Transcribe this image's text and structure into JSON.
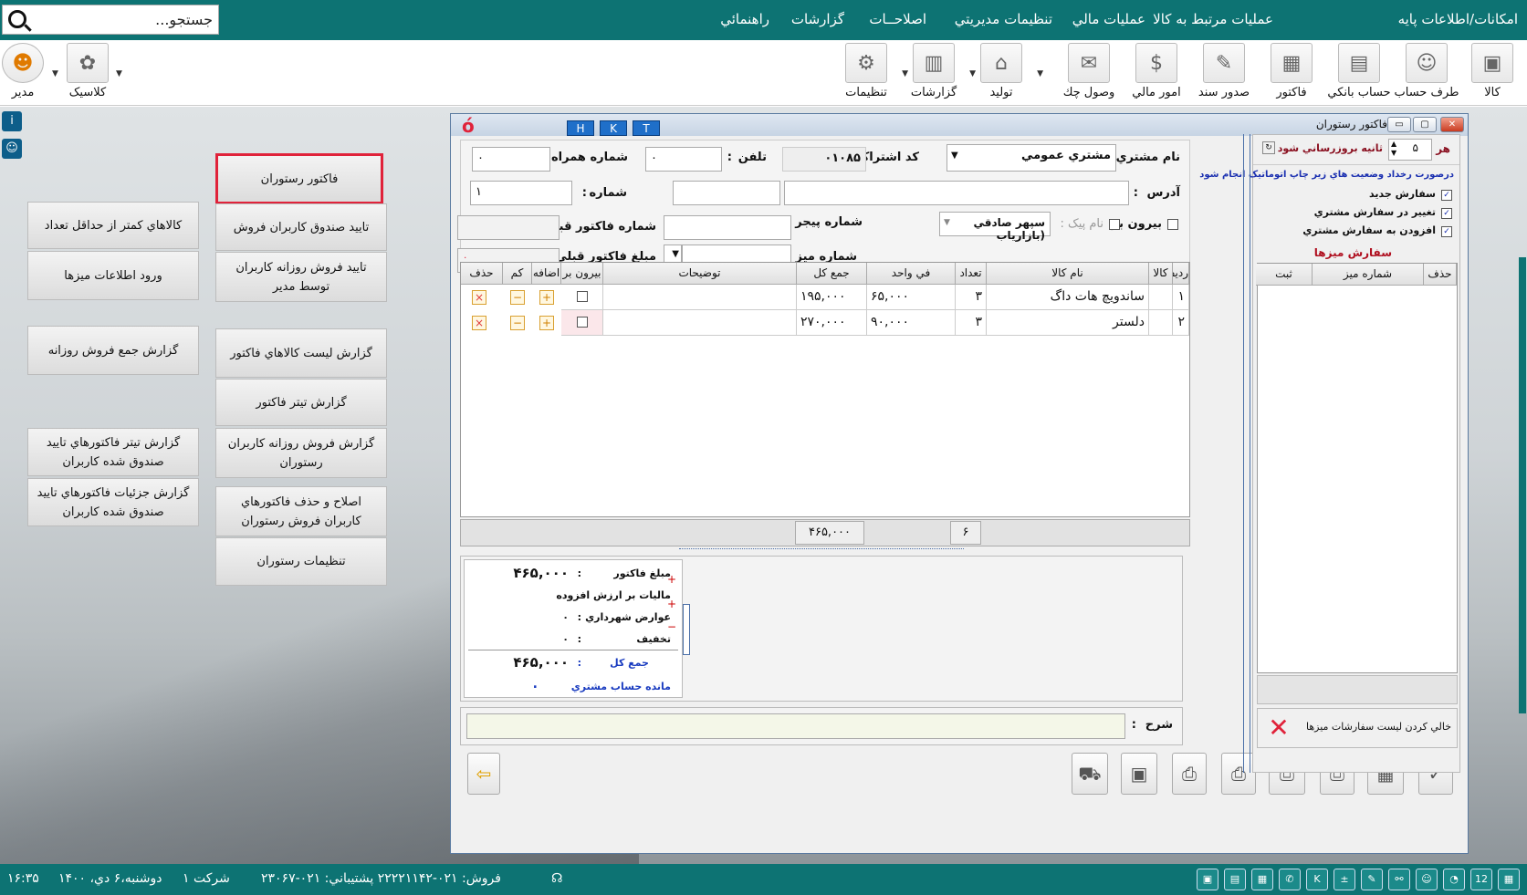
{
  "search": {
    "placeholder": "جستجو..."
  },
  "menu": [
    "امکانات/اطلاعات پايه",
    "عمليات مرتبط به کالا",
    "عمليات مالي",
    "تنظيمات مديريتي",
    "اصلاحــات",
    "گزارشات",
    "راهنمائي"
  ],
  "toolbar": {
    "right": [
      {
        "label": "کالا",
        "icon": "box-icon"
      },
      {
        "label": "طرف حساب",
        "icon": "person-icon"
      },
      {
        "label": "حساب بانکي",
        "icon": "bank-card-icon"
      },
      {
        "label": "فاکتور",
        "icon": "invoice-icon"
      },
      {
        "label": "صدور سند",
        "icon": "document-icon"
      },
      {
        "label": "امور مالي",
        "icon": "finance-icon"
      },
      {
        "label": "وصول چك",
        "icon": "cheque-icon"
      },
      {
        "label": "توليد",
        "icon": "production-icon"
      },
      {
        "label": "گزارشات",
        "icon": "report-icon"
      },
      {
        "label": "تنظيمات",
        "icon": "gear-icon"
      }
    ],
    "left": [
      {
        "label": "کلاسيک",
        "icon": "palette-icon"
      },
      {
        "label": "مدير",
        "icon": "user-icon"
      }
    ]
  },
  "left_buttons": [
    {
      "label": "فاكتور رستوران",
      "selected": true
    },
    {
      "label": "تاييد صندوق كاربران فروش"
    },
    {
      "label": "تاييد فروش روزانه کاربران توسط مدير"
    },
    {
      "label": "گزارش ليست كالاهاي فاكتور"
    },
    {
      "label": "گزارش تيتر فاكتور"
    },
    {
      "label": "گزارش فروش روزانه کاربران رستوران"
    },
    {
      "label": "اصلاح و حذف فاكتورهاي كاربران فروش رستوران"
    },
    {
      "label": "تنظيمات رستوران"
    },
    {
      "label": "كالاهاي كمتر از حداقل تعداد"
    },
    {
      "label": "ورود اطلاعات ميزها"
    },
    {
      "label": "گزارش جمع فروش روزانه"
    },
    {
      "label": "گزارش تيتر فاكتورهاي تاييد صندوق شده كاربران"
    },
    {
      "label": "گزارش جزئيات فاكتورهاي تاييد صندوق شده كاربران"
    }
  ],
  "window": {
    "title": "فاكتور رستوران",
    "hkt": [
      "H",
      "K",
      "T"
    ],
    "customer_label": "نام مشتري :",
    "customer_value": "مشتري عمومي",
    "subscription_label": "کد اشتراک :",
    "subscription_value": "۰۱۰۸۵",
    "phone_label": "تلفن",
    "phone_value": "۰",
    "mobile_label": "شماره همراه :",
    "mobile_value": "۰",
    "address_label": "آدرس",
    "number_label": "شماره",
    "number_value": "۱",
    "takeout_label": "بيرون بر",
    "courier_label": "نام پيک :",
    "courier_value": "سپهر صادقي (بازارياب",
    "pager_label": "شماره پيجر :",
    "prev_invoice_no_label": "شماره فاكتور قبلي :",
    "table_no_label": "شماره ميز :",
    "prev_invoice_amt_label": "مبلغ فاكتور قبلي :",
    "prev_invoice_amt_value": "۰"
  },
  "grid": {
    "headers": [
      "رديف",
      "كالا",
      "نام كالا",
      "تعداد",
      "في واحد",
      "جمع كل",
      "توضيحات",
      "بيرون بر",
      "اضافه",
      "کم",
      "حذف"
    ],
    "rows": [
      {
        "idx": "۱",
        "name": "ساندويچ هات داگ",
        "qty": "۳",
        "unit": "۶۵,۰۰۰",
        "total": "۱۹۵,۰۰۰"
      },
      {
        "idx": "۲",
        "name": "دلستر",
        "qty": "۳",
        "unit": "۹۰,۰۰۰",
        "total": "۲۷۰,۰۰۰"
      }
    ],
    "footer_qty": "۶",
    "footer_total": "۴۶۵,۰۰۰"
  },
  "summary": {
    "invoice_amt_label": "مبلغ فاكتور",
    "invoice_amt": "۴۶۵,۰۰۰",
    "vat_label": "ماليات بر ارزش افزوده",
    "vat": "۰",
    "municipal_label": "عوارض شهرداري",
    "municipal": "۰",
    "discount_label": "تخفيف",
    "discount": "۰",
    "total_label": "جمع كل",
    "total": "۴۶۵,۰۰۰",
    "balance_label": "مانده حساب مشتري",
    "balance": "."
  },
  "desc_label": "شرح",
  "panel": {
    "every_label": "هر",
    "every_value": "۵",
    "seconds_label": "ثانيه بروزرساني شود",
    "note": "درصورت رخداد وضعيت هاي زير چاپ اتوماتيک انجام شود",
    "opts": [
      "سفارش جديد",
      "تغيير در سفارش مشتري",
      "افزودن به سفارش مشتري"
    ],
    "orders_title": "سفارش ميزها",
    "cols": [
      "حذف",
      "شماره ميز",
      "ثبت"
    ],
    "clear_label": "خالي كردن ليست سفارشات ميزها"
  },
  "status": {
    "company": "شرکت ۱",
    "date": "دوشنبه،۶ دي، ۱۴۰۰",
    "time": "۱۶:۳۵",
    "sales": "فروش:  ۰۲۱-۲۲۲۲۱۱۴۲  پشتيباني: ۰۲۱-۲۳۰۶۷"
  }
}
